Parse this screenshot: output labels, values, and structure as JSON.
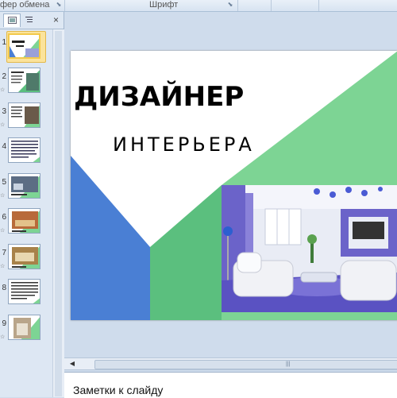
{
  "ribbon": {
    "clipboard_label": "фер обмена",
    "font_label": "Шрифт"
  },
  "slides_pane": {
    "close_glyph": "×",
    "slides": [
      {
        "number": "1",
        "selected": true
      },
      {
        "number": "2",
        "selected": false
      },
      {
        "number": "3",
        "selected": false
      },
      {
        "number": "4",
        "selected": false
      },
      {
        "number": "5",
        "selected": false
      },
      {
        "number": "6",
        "selected": false
      },
      {
        "number": "7",
        "selected": false
      },
      {
        "number": "8",
        "selected": false
      },
      {
        "number": "9",
        "selected": false
      }
    ]
  },
  "slide": {
    "title_line1": "ДИЗАЙНЕР",
    "title_line2": "ИНТЕРЬЕРА",
    "colors": {
      "green": "#7dd494",
      "dark_green": "#5bbf7e",
      "blue": "#4a7fd4",
      "purple": "#6b63c9"
    }
  },
  "notes": {
    "placeholder": "Заметки к слайду"
  }
}
